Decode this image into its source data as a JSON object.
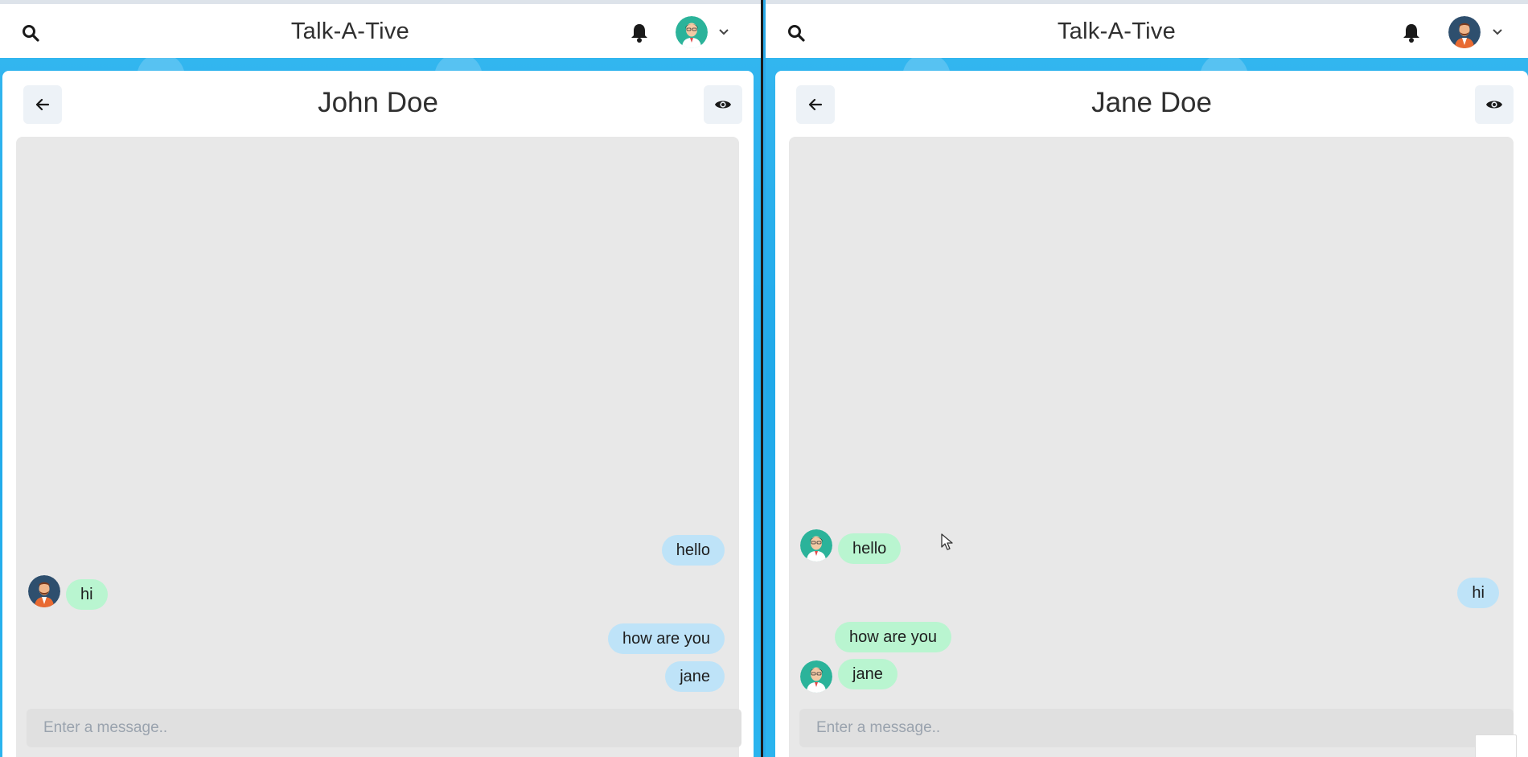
{
  "app": {
    "title": "Talk-A-Tive"
  },
  "icons": {
    "search": "search-icon",
    "bell": "bell-icon",
    "chevron": "chevron-down-icon",
    "back": "arrow-left-icon",
    "eye": "eye-icon"
  },
  "colors": {
    "background_accent": "#2aa9e7",
    "sent_bubble": "#bee3f8",
    "received_bubble": "#b9f5d0",
    "message_area": "#e8e8e8"
  },
  "left": {
    "app_title": "Talk-A-Tive",
    "chat_name": "John Doe",
    "input_placeholder": "Enter a message..",
    "messages": [
      {
        "text": "hello",
        "side": "sent"
      },
      {
        "text": "hi",
        "side": "received"
      },
      {
        "text": "how are you",
        "side": "sent"
      },
      {
        "text": "jane",
        "side": "sent"
      }
    ]
  },
  "right": {
    "app_title": "Talk-A-Tive",
    "chat_name": "Jane Doe",
    "input_placeholder": "Enter a message..",
    "messages": [
      {
        "text": "hello",
        "side": "received"
      },
      {
        "text": "hi",
        "side": "sent"
      },
      {
        "text": "how are you",
        "side": "received"
      },
      {
        "text": "jane",
        "side": "received"
      }
    ]
  }
}
